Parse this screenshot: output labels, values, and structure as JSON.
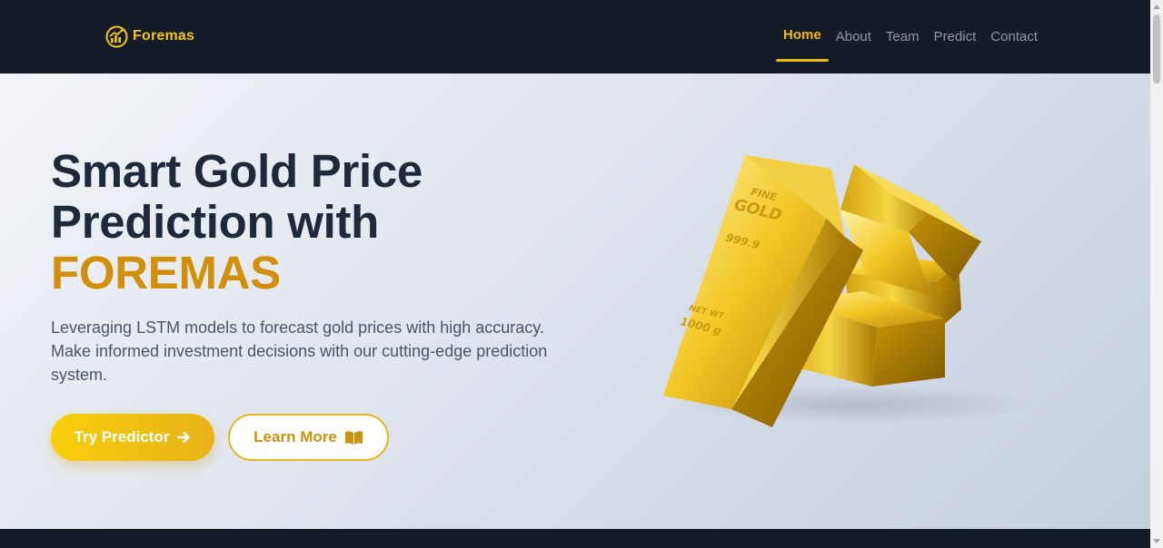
{
  "brand": {
    "name": "Foremas",
    "icon": "chart-growth-circle-icon",
    "color": "#f5c518"
  },
  "nav": {
    "items": [
      {
        "label": "Home",
        "active": true
      },
      {
        "label": "About",
        "active": false
      },
      {
        "label": "Team",
        "active": false
      },
      {
        "label": "Predict",
        "active": false
      },
      {
        "label": "Contact",
        "active": false
      }
    ]
  },
  "hero": {
    "title_line1": "Smart Gold Price",
    "title_line2": "Prediction with",
    "title_accent": "FOREMAS",
    "description": "Leveraging LSTM models to forecast gold prices with high accuracy. Make informed investment decisions with our cutting-edge prediction system.",
    "primary_button": {
      "label": "Try Predictor",
      "icon": "arrow-right-icon"
    },
    "secondary_button": {
      "label": "Learn More",
      "icon": "open-book-icon"
    },
    "image": {
      "name": "gold-bars-image",
      "bar_text": [
        "FINE",
        "GOLD",
        "999.9",
        "NET WT",
        "1000 g"
      ]
    }
  },
  "colors": {
    "nav_background": "#131c28",
    "accent": "#f1b90f",
    "title_accent": "#d18f0a",
    "title": "#1e293b"
  }
}
